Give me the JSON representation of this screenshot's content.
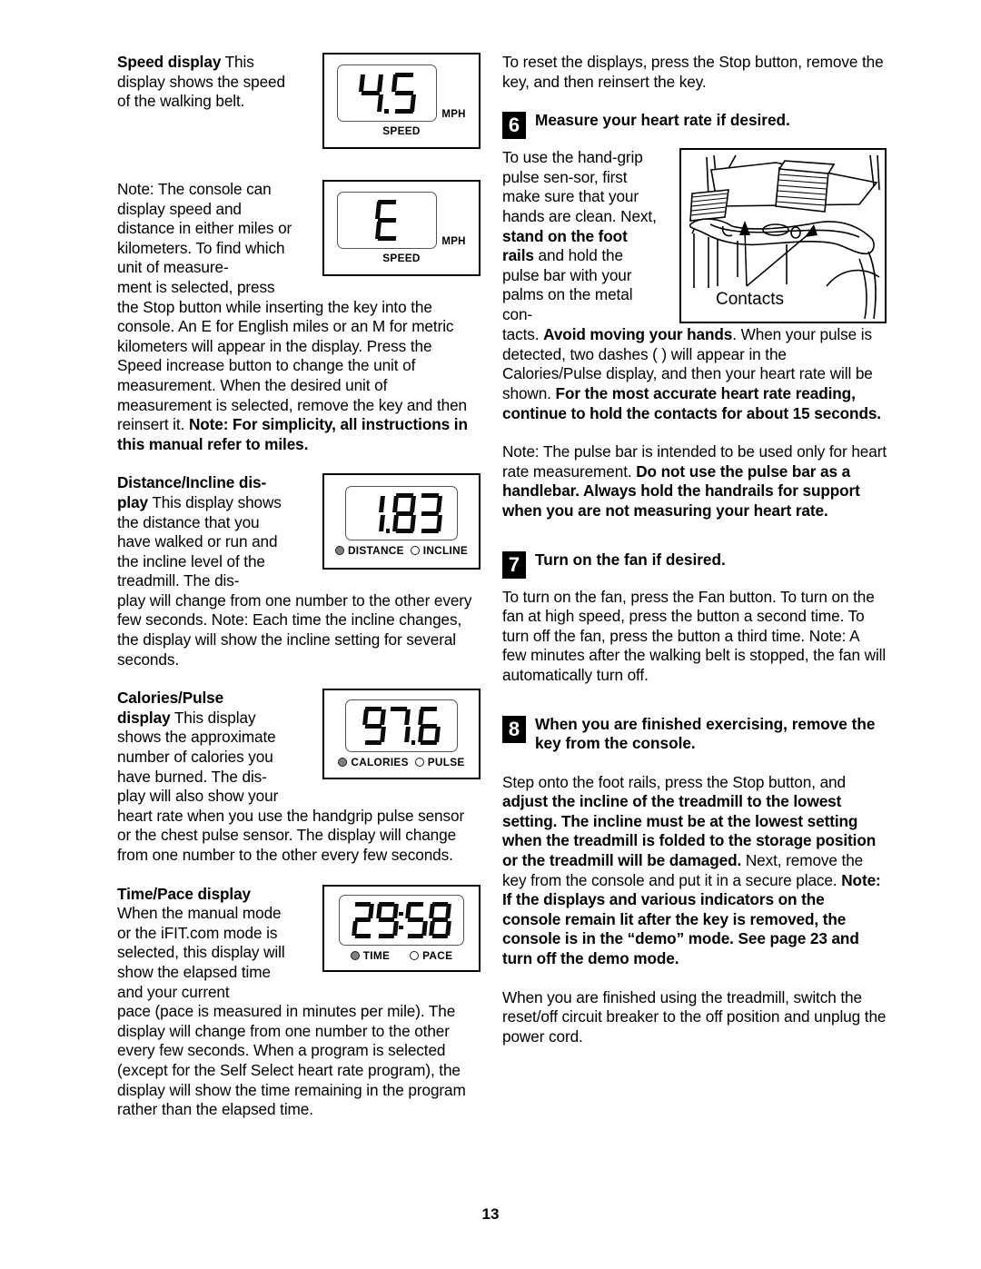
{
  "page": {
    "number": "13"
  },
  "left_column": {
    "speed_section": {
      "heading": "Speed display",
      "text": " This display shows the speed of the walking belt.",
      "display": {
        "value": "4.5",
        "unit": "MPH",
        "caption": "SPEED"
      }
    },
    "note_units": {
      "text_part1": "Note: The console can display speed and distance in either miles or kilometers. To find which unit of measure-",
      "text_part2": "ment is selected, press",
      "text_part3": "the Stop button while inserting the key into the console. An  E  for English miles or an  M  for metric kilometers will appear in the display. Press the Speed increase button to change the unit of measurement. When the desired unit of measurement is selected, remove the key and then reinsert it. ",
      "bold_tail": "Note: For simplicity, all instructions in this manual refer to miles.",
      "display": {
        "value": "E",
        "unit": "MPH",
        "caption": "SPEED"
      }
    },
    "distance_section": {
      "heading": "Distance/Incline dis-play",
      "heading_line1": "Distance/Incline dis-",
      "heading_line2": "play",
      "text_wrapped": " This display shows the distance that you have walked or run and the incline level of the treadmill. The dis-",
      "text_full": "play will change from one number to the other every few seconds. Note: Each time the incline changes, the display will show the incline setting for several seconds.",
      "display": {
        "value": "1.83",
        "led_on_label": "DISTANCE",
        "led_off_label": "INCLINE"
      }
    },
    "calories_section": {
      "heading_line1": "Calories/Pulse",
      "heading_line2": "display",
      "text_wrapped": " This display shows the approximate number of calories you have burned. The dis-play will also show your",
      "text_full": "heart rate when you use the handgrip pulse sensor or the chest pulse sensor. The display will change from one number to the other every few seconds.",
      "display": {
        "value": "97.6",
        "led_on_label": "CALORIES",
        "led_off_label": "PULSE"
      }
    },
    "time_section": {
      "heading": "Time/Pace display",
      "text_wrapped": "When the manual mode or the iFIT.com mode is selected, this display will show the elapsed time and your current",
      "text_full": "pace (pace is measured in minutes per mile). The display will change from one number to the other every few seconds. When a program is selected (except for the Self Select heart rate program), the display will show the time remaining in the program rather than the elapsed time.",
      "display": {
        "value": "29:58",
        "led_on_label": "TIME",
        "led_off_label": "PACE"
      }
    }
  },
  "right_column": {
    "reset_para": "To reset the displays, press the Stop button, remove the key, and then reinsert the key.",
    "step6": {
      "number": "6",
      "title": "Measure your heart rate if desired.",
      "body_wrapped_part1": "To use the hand-grip pulse sen-sor, first make sure that your hands are clean. Next, ",
      "body_wrapped_bold": "stand on the foot rails",
      "body_wrapped_part2": " and hold the pulse bar with your palms on the metal con-",
      "body_full_part1": "tacts. ",
      "body_full_bold1": "Avoid moving your hands",
      "body_full_part2": ". When your pulse is detected, two dashes (   ) will appear in the Calories/Pulse display, and then your heart rate will be shown. ",
      "body_full_bold2": "For the most accurate heart rate reading, continue to hold the contacts for about 15 seconds.",
      "note_part1": "Note: The pulse bar is intended to be used only for heart rate measurement. ",
      "note_bold": "Do not use the pulse bar as a handlebar. Always hold the handrails for support when you are not measuring your heart rate.",
      "illustration_label": "Contacts"
    },
    "step7": {
      "number": "7",
      "title": "Turn on the fan if desired.",
      "body": "To turn on the fan, press the Fan button. To turn on the fan at high speed, press the button a second time. To turn off the fan, press the button a third time. Note: A few minutes after the walking belt is stopped, the fan will automatically turn off."
    },
    "step8": {
      "number": "8",
      "title": "When you are finished exercising, remove the key from the console.",
      "body_part1": "Step onto the foot rails, press the Stop button, and ",
      "body_bold1": "adjust the incline of the treadmill to the lowest setting. The incline must be at the lowest setting when the treadmill is folded to the storage position or the treadmill will be damaged.",
      "body_part2": " Next, remove the key from the console and put it in a secure place. ",
      "body_bold2": "Note: If the displays and various indicators on the console remain lit after the key is removed, the console is in the “demo” mode. See page 23 and turn off the demo mode.",
      "closing": "When you are finished using the treadmill, switch the reset/off circuit breaker to the off position and unplug the power cord."
    }
  }
}
